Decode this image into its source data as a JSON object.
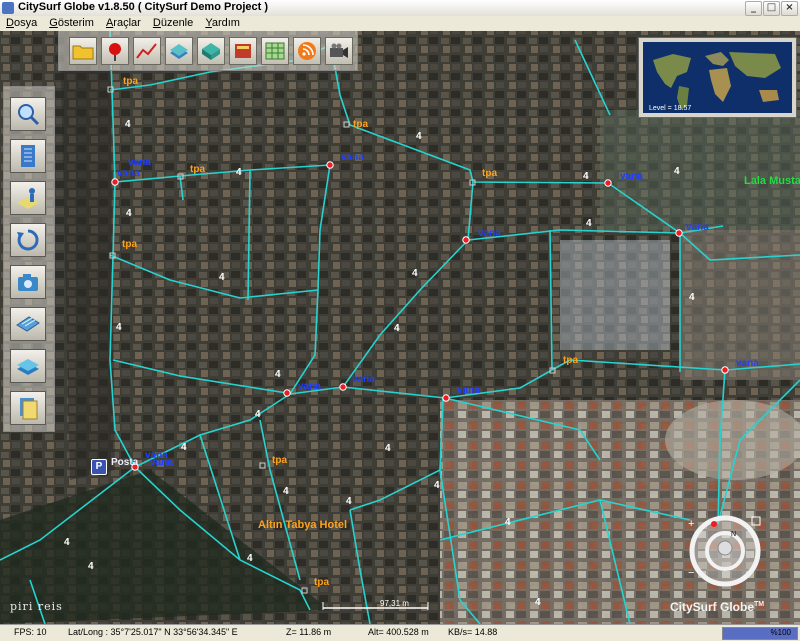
{
  "window": {
    "title": "CitySurf Globe v1.8.50    ( CitySurf Demo Project )",
    "controls": [
      "_",
      "□",
      "×"
    ]
  },
  "menu": [
    {
      "letter": "D",
      "rest": "osya"
    },
    {
      "letter": "G",
      "rest": "österim"
    },
    {
      "letter": "A",
      "rest": "raçlar"
    },
    {
      "letter": "D",
      "rest": "üzenle"
    },
    {
      "letter": "Y",
      "rest": "ardım"
    }
  ],
  "toolbar_icons": [
    "folder-icon",
    "red-pin-icon",
    "line-chart-icon",
    "layer-stack-icon",
    "cube-icon",
    "book-icon",
    "grid-table-icon",
    "rss-icon",
    "video-camera-icon"
  ],
  "side_icons": [
    "magnifier-icon",
    "building-icon",
    "person-layer-icon",
    "rotate-icon",
    "camera-icon",
    "keyboard-icon",
    "layer-icon",
    "documents-icon"
  ],
  "minimap": {
    "level_text": "Level = 18.57"
  },
  "map_labels": {
    "tpa": "tpa",
    "vana": "vana",
    "four": "4",
    "hotel": "Altın Tabya Hotel",
    "street": "Lala Musta",
    "posta": "Posta",
    "parking": "P"
  },
  "branding": {
    "left": "piri  reis",
    "right": "CitySurf Globe",
    "tm": "TM"
  },
  "scale": "97,31 m",
  "status": {
    "fps": "FPS: 10",
    "latlong": "Lat/Long : 35°7'25.017\" N   33°56'34.345\" E",
    "z": "Z= 11.86 m",
    "alt": "Alt= 400.528 m",
    "kbs": "KB/s= 14.88",
    "zoom": "%100",
    "zoom_fraction": 1.0
  },
  "colors": {
    "road": "#27d3cf",
    "valve": "#ee1c24",
    "tpa": "#ffa21a",
    "vana": "#2040ff",
    "street": "#22dd44",
    "status_fill": "#3c55b8"
  }
}
